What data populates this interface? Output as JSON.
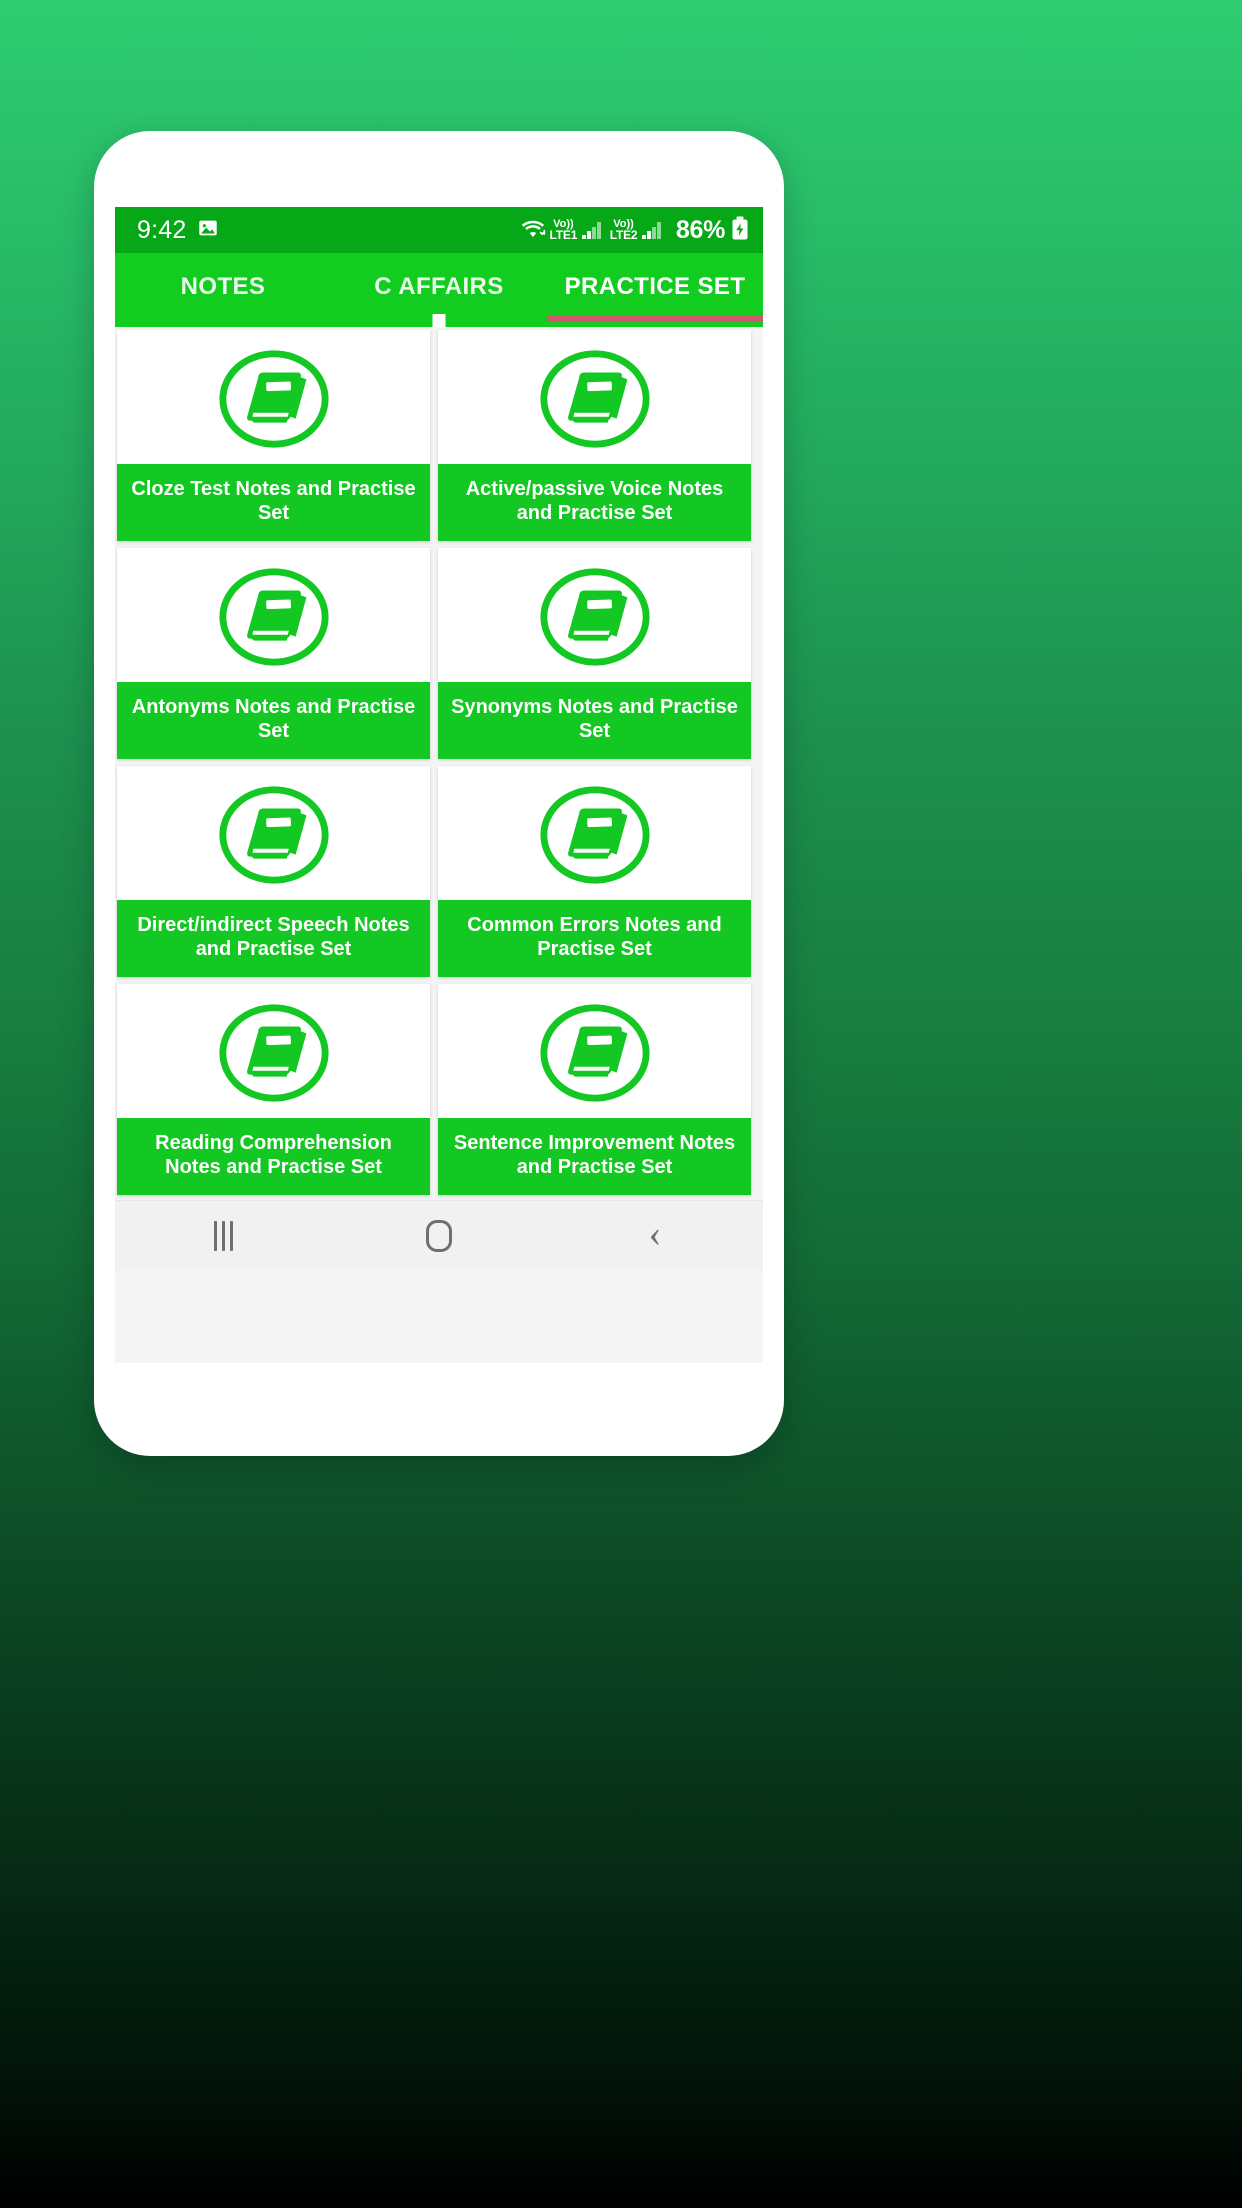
{
  "theme": {
    "bg_gradient_top": "#2ecc71",
    "bg_gradient_bottom": "#000000",
    "status_bar_green": "#07a818",
    "tab_bar_green": "#12cc20",
    "card_label_green": "#13c823",
    "active_tab_indicator": "#d4566e",
    "icon_green": "#13c823",
    "nav_bar_gray": "#f1f1f1"
  },
  "status_bar": {
    "time": "9:42",
    "left_icons": [
      "image-icon"
    ],
    "wifi_icon": "wifi-icon",
    "sim1_label_top": "Vo))",
    "sim1_label_bottom": "LTE1",
    "sim2_label_top": "Vo))",
    "sim2_label_bottom": "LTE2",
    "battery_percent": "86%",
    "battery_icon": "battery-charging-icon"
  },
  "tabs": [
    {
      "label": "NOTES",
      "active": false
    },
    {
      "label": "C AFFAIRS",
      "active": false
    },
    {
      "label": "PRACTICE SET",
      "active": true
    }
  ],
  "grid": {
    "icon_name": "book-circle-icon",
    "cards": [
      {
        "label": "Cloze Test Notes and Practise Set"
      },
      {
        "label": "Active/passive Voice Notes and Practise Set"
      },
      {
        "label": "Antonyms Notes and Practise Set"
      },
      {
        "label": "Synonyms Notes and Practise Set"
      },
      {
        "label": "Direct/indirect Speech Notes and Practise Set"
      },
      {
        "label": "Common Errors Notes and Practise Set"
      },
      {
        "label": "Reading Comprehension Notes and Practise Set"
      },
      {
        "label": "Sentence Improvement Notes and Practise Set"
      },
      {
        "label": ""
      },
      {
        "label": ""
      }
    ]
  },
  "nav_bar": {
    "recents_label": "recent-apps",
    "home_label": "home",
    "back_label": "back"
  }
}
